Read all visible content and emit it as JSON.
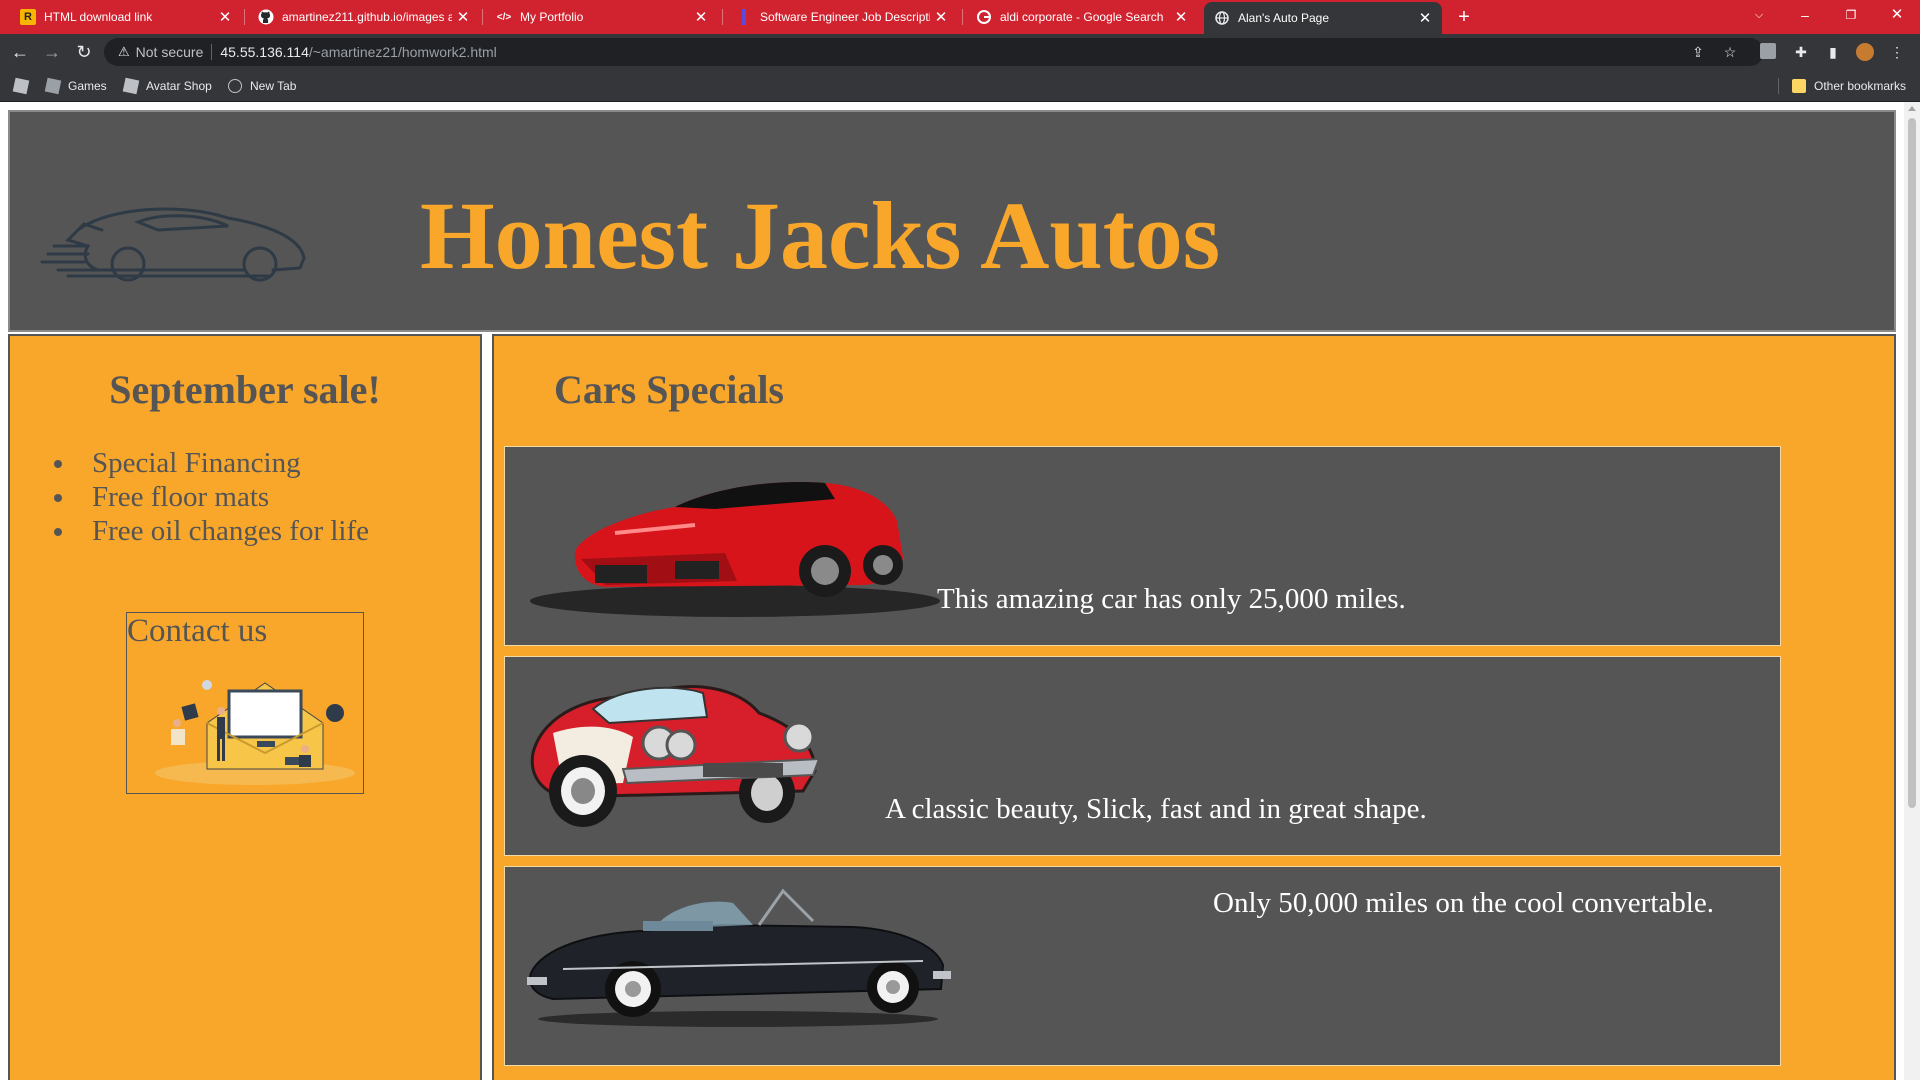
{
  "browser": {
    "tabs": [
      {
        "title": "HTML download link",
        "favicon": "R"
      },
      {
        "title": "amartinez211.github.io/images a",
        "favicon": "github-icon"
      },
      {
        "title": "My Portfolio",
        "favicon": "</>"
      },
      {
        "title": "Software Engineer Job Descriptic",
        "favicon": "document-icon"
      },
      {
        "title": "aldi corporate - Google Search",
        "favicon": "google-icon"
      },
      {
        "title": "Alan's Auto Page",
        "favicon": "globe-icon"
      }
    ],
    "address": {
      "security_label": "Not secure",
      "host": "45.55.136.114",
      "path": "/~amartinez21/homwork2.html"
    },
    "bookmarks": [
      {
        "label": "Games"
      },
      {
        "label": "Avatar Shop"
      },
      {
        "label": "New Tab"
      }
    ],
    "other_bookmarks": "Other bookmarks",
    "colors": {
      "tab_strip": "#d1232f",
      "toolbar": "#35363a"
    }
  },
  "page": {
    "site_title": "Honest Jacks Autos",
    "sidebar": {
      "title": "September sale!",
      "perks": [
        "Special Financing",
        "Free floor mats",
        "Free oil changes for life"
      ],
      "contact_label": "Contact us"
    },
    "specials": {
      "title": "Cars Specials",
      "cars": [
        {
          "caption": "This amazing car has only 25,000 miles.",
          "image": "red-sports-car"
        },
        {
          "caption": "A classic beauty, Slick, fast and in great shape.",
          "image": "classic-red-corvette"
        },
        {
          "caption": "Only 50,000 miles on the cool convertable.",
          "image": "black-vintage-convertible"
        }
      ]
    },
    "colors": {
      "accent": "#f9a72a",
      "panel": "#555555",
      "text_on_panel": "#ffffff"
    }
  }
}
